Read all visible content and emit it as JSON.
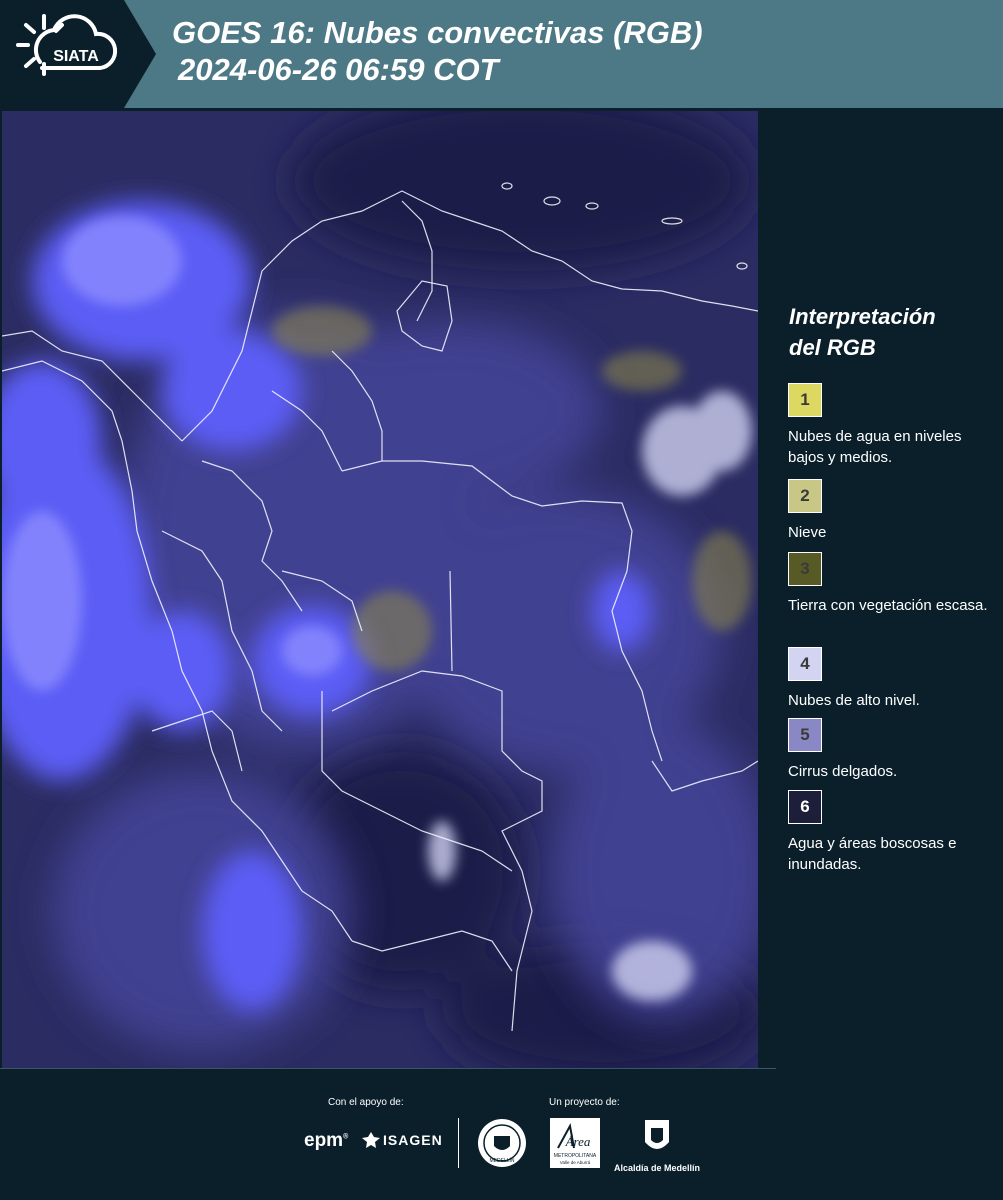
{
  "header": {
    "logo_text": "SIATA",
    "title_line1": "GOES 16: Nubes convectivas (RGB)",
    "title_line2": "2024-06-26 06:59 COT"
  },
  "legend": {
    "title_line1": "Interpretación",
    "title_line2": "del RGB",
    "items": [
      {
        "number": "1",
        "color": "#dcd862",
        "label": "Nubes de agua en niveles bajos y medios."
      },
      {
        "number": "2",
        "color": "#c9c786",
        "label": "Nieve"
      },
      {
        "number": "3",
        "color": "#585a26",
        "label": "Tierra con vegetación escasa."
      },
      {
        "number": "4",
        "color": "#d2d4f1",
        "label": "Nubes de alto nivel."
      },
      {
        "number": "5",
        "color": "#8a88c4",
        "label": "Cirrus delgados."
      },
      {
        "number": "6",
        "color": "#1d1f3a",
        "label": "Agua y áreas boscosas e inundadas."
      }
    ]
  },
  "footer": {
    "support_label": "Con el apoyo de:",
    "project_label": "Un proyecto de:",
    "epm": "epm",
    "isagen": "ISAGEN",
    "area_line1": "Área",
    "area_line2": "METROPOLITANA",
    "area_line3": "Valle de Aburrá",
    "seal_text": "MEDELLÍN",
    "alcaldia": "Alcaldía de Medellín"
  },
  "colors": {
    "header_bg": "#4d7886",
    "logo_bg": "#0b1f2b",
    "sidebar_bg": "#0b1f2b",
    "map_bg": "#2a2b63",
    "cloud": "#5a5cf0"
  }
}
